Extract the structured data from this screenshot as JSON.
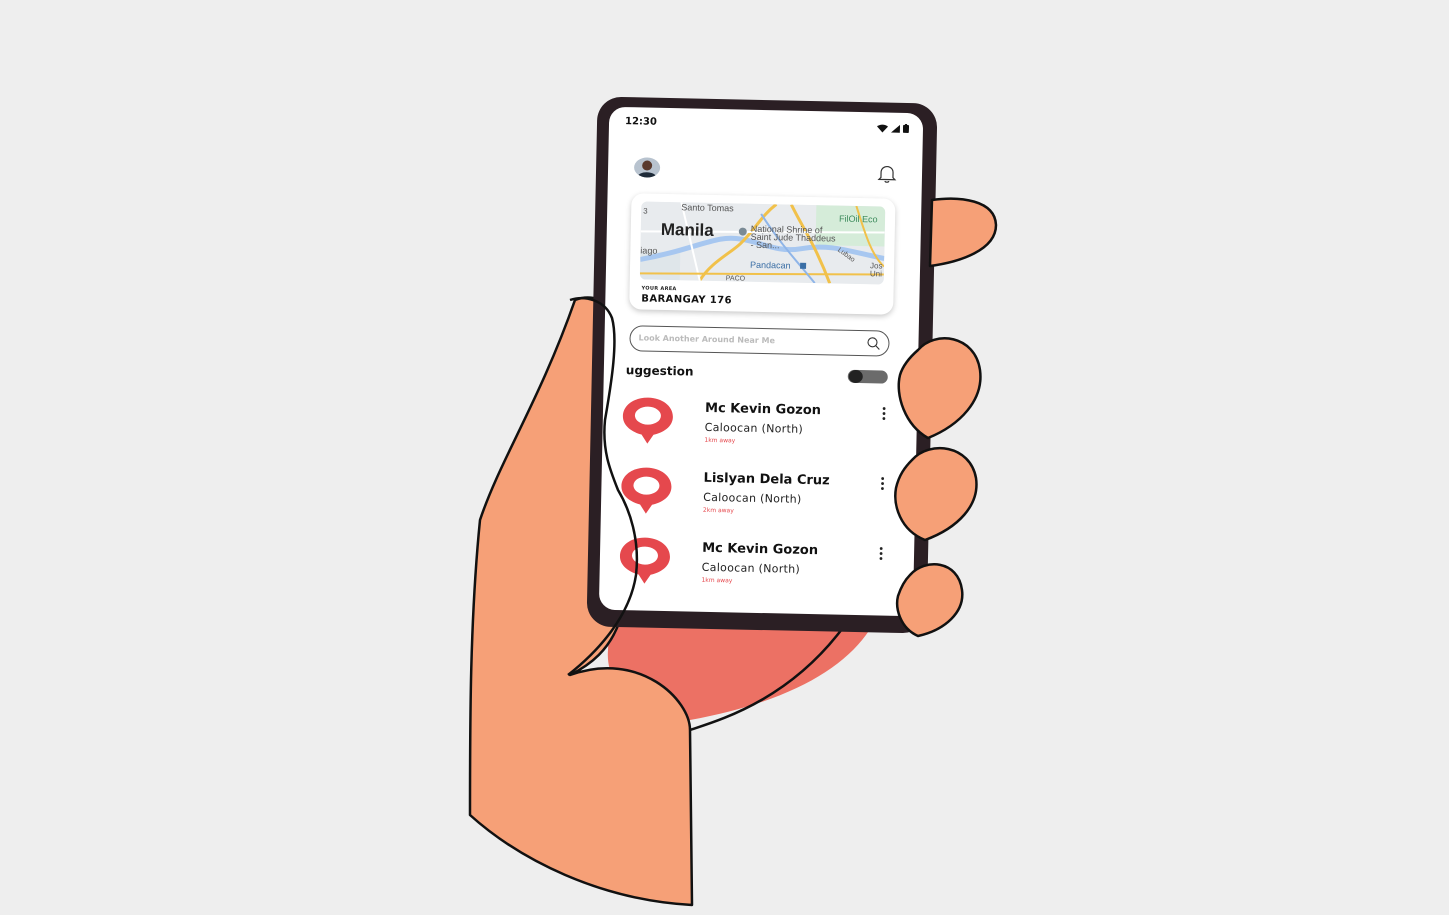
{
  "status_bar": {
    "time": "12:30",
    "icons": [
      "wifi-icon",
      "signal-icon",
      "battery-icon"
    ]
  },
  "header": {
    "avatar": "avatar",
    "bell": "bell-icon"
  },
  "map_card": {
    "map_labels": {
      "city": "Manila",
      "santo_tomas": "Santo Tomas",
      "shrine": "National Shrine of Saint Jude Thaddeus - San...",
      "filoil": "FilOil Eco",
      "pandacan": "Pandacan",
      "iago": "iago",
      "paco": "PACO",
      "lubao": "Lubao",
      "jos": "Jos",
      "uni": "Uni",
      "corner_number": "3"
    },
    "caption": "YOUR AREA",
    "area_name": "BARANGAY 176"
  },
  "search": {
    "placeholder": "Look Another Around Near Me"
  },
  "suggestion": {
    "label": "uggestion",
    "toggle_on": false
  },
  "list": [
    {
      "name": "Mc Kevin Gozon",
      "location": "Caloocan (North)",
      "distance": "1km away"
    },
    {
      "name": "Lislyan Dela Cruz",
      "location": "Caloocan (North)",
      "distance": "2km away"
    },
    {
      "name": "Mc Kevin Gozon",
      "location": "Caloocan (North)",
      "distance": "1km away"
    }
  ],
  "colors": {
    "background": "#eeeeee",
    "skin": "#f6a077",
    "palm_shadow": "#ec7164",
    "phone_body": "#2b1f24",
    "pin_red": "#e5484d",
    "distance_red": "#e5484d"
  }
}
